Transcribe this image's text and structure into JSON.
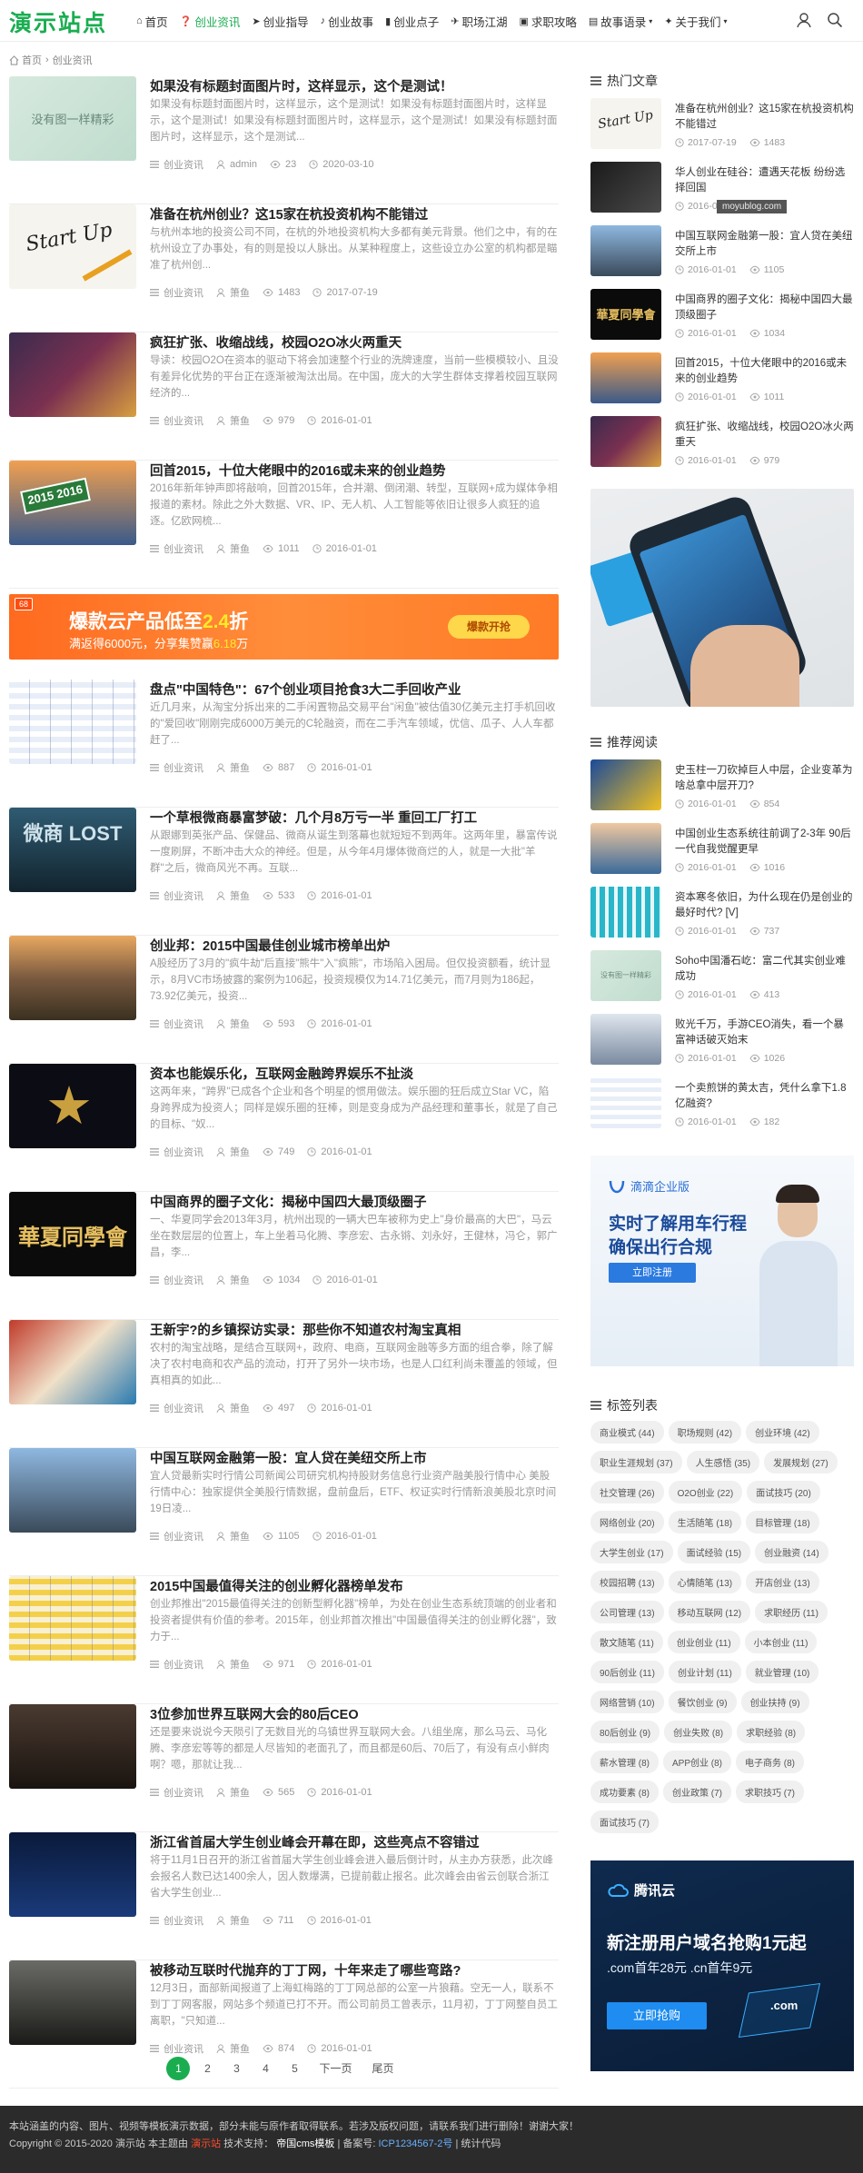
{
  "site": {
    "logo": "演示站点",
    "watermark": "moyublog.com"
  },
  "nav": [
    {
      "label": "首页",
      "icon": "home-icon",
      "glyph": "⌂",
      "active": false
    },
    {
      "label": "创业资讯",
      "icon": "question-icon",
      "glyph": "❓",
      "active": true
    },
    {
      "label": "创业指导",
      "icon": "send-icon",
      "glyph": "➤",
      "active": false
    },
    {
      "label": "创业故事",
      "icon": "bell-icon",
      "glyph": "♪",
      "active": false
    },
    {
      "label": "创业点子",
      "icon": "columns-icon",
      "glyph": "▮",
      "active": false
    },
    {
      "label": "职场江湖",
      "icon": "ticket-icon",
      "glyph": "✈",
      "active": false
    },
    {
      "label": "求职攻略",
      "icon": "print-icon",
      "glyph": "▣",
      "active": false
    },
    {
      "label": "故事语录",
      "icon": "book-icon",
      "glyph": "▤",
      "active": false,
      "dropdown": true
    },
    {
      "label": "关于我们",
      "icon": "user-icon",
      "glyph": "✦",
      "active": false,
      "dropdown": true
    }
  ],
  "breadcrumb": {
    "home": "首页",
    "sep": "›",
    "current": "创业资讯"
  },
  "articles": [
    {
      "title": "如果没有标题封面图片时，这样显示，这个是测试！",
      "summary": "如果没有标题封面图片时，这样显示，这个是测试！如果没有标题封面图片时，这样显示，这个是测试！如果没有标题封面图片时，这样显示，这个是测试！如果没有标题封面图片时，这样显示，这个是测试...",
      "cat": "创业资讯",
      "author": "admin",
      "views": "23",
      "date": "2020-03-10",
      "thumb_text": "没有图一样精彩"
    },
    {
      "title": "准备在杭州创业？这15家在杭投资机构不能错过",
      "summary": "与杭州本地的投资公司不同，在杭的外地投资机构大多都有美元背景。他们之中，有的在杭州设立了办事处，有的则是投以人脉出。从某种程度上，这些设立办公室的机构都是瞄准了杭州创...",
      "cat": "创业资讯",
      "author": "箫鱼",
      "views": "1483",
      "date": "2017-07-19",
      "thumb_text": "Start Up"
    },
    {
      "title": "疯狂扩张、收缩战线，校园O2O冰火两重天",
      "summary": "导读：校园O2O在资本的驱动下将会加速整个行业的洗牌速度，当前一些模模较小、且没有差异化优势的平台正在逐渐被淘汰出局。在中国，庞大的大学生群体支撑着校园互联网经济的...",
      "cat": "创业资讯",
      "author": "箫鱼",
      "views": "979",
      "date": "2016-01-01",
      "thumb_text": ""
    },
    {
      "title": "回首2015，十位大佬眼中的2016或未来的创业趋势",
      "summary": "2016年新年钟声即将敲响，回首2015年，合并潮、倒闭潮、转型，互联网+成为媒体争相报道的素材。除此之外大数据、VR、IP、无人机、人工智能等依旧让很多人疯狂的追逐。亿欧网梳...",
      "cat": "创业资讯",
      "author": "箫鱼",
      "views": "1011",
      "date": "2016-01-01",
      "thumb_text": "2015 2016"
    },
    {
      "title": "盘点\"中国特色\"：67个创业项目抢食3大二手回收产业",
      "summary": "近几月来，从淘宝分拆出来的二手闲置物品交易平台\"闲鱼\"被估值30亿美元主打手机回收的\"爱回收\"刚刚完成6000万美元的C轮融资，而在二手汽车领域，优信、瓜子、人人车都赶了...",
      "cat": "创业资讯",
      "author": "箫鱼",
      "views": "887",
      "date": "2016-01-01",
      "thumb_text": ""
    },
    {
      "title": "一个草根微商暴富梦破：几个月8万亏一半 重回工厂打工",
      "summary": "从跟娜到英张产品、保健品、微商从诞生到落幕也就短短不到两年。这两年里，暴富传说一度刷屏，不断冲击大众的神经。但是，从今年4月爆体微商烂的人，就是一大批\"羊群\"之后，微商风光不再。互联...",
      "cat": "创业资讯",
      "author": "箫鱼",
      "views": "533",
      "date": "2016-01-01",
      "thumb_text": "微商 LOST"
    },
    {
      "title": "创业邦：2015中国最佳创业城市榜单出炉",
      "summary": "A股经历了3月的\"疯牛劫\"后直接\"熊牛\"入\"疯熊\"，市场陷入困局。但仅投资额看，统计显示，8月VC市场披露的案例为106起，投资规模仅为14.71亿美元，而7月则为186起，73.92亿美元，投资...",
      "cat": "创业资讯",
      "author": "箫鱼",
      "views": "593",
      "date": "2016-01-01",
      "thumb_text": ""
    },
    {
      "title": "资本也能娱乐化，互联网金融跨界娱乐不扯淡",
      "summary": "这两年来，\"跨界\"已成各个企业和各个明星的惯用做法。娱乐圈的狂后成立Star VC，陷身跨界成为投资人；同样是娱乐圈的狂棒，则是变身成为产品经理和董事长，就是了自己的目标、\"奴...",
      "cat": "创业资讯",
      "author": "箫鱼",
      "views": "749",
      "date": "2016-01-01",
      "thumb_text": ""
    },
    {
      "title": "中国商界的圈子文化：揭秘中国四大最顶级圈子",
      "summary": "一、华夏同学会2013年3月，杭州出现的一辆大巴车被称为史上\"身价最高的大巴\"，马云坐在数层层的位置上，车上坐着马化腾、李彦宏、古永锵、刘永好，王健林，冯仑，郭广昌，李...",
      "cat": "创业资讯",
      "author": "箫鱼",
      "views": "1034",
      "date": "2016-01-01",
      "thumb_text": "華夏同學會"
    },
    {
      "title": "王新宇?的乡镇探访实录：那些你不知道农村淘宝真相",
      "summary": "农村的淘宝战略，是结合互联网+，政府、电商，互联网金融等多方面的组合拳，除了解决了农村电商和农产品的流动，打开了另外一块市场，也是人口红利尚未覆盖的领域，但真相真的如此...",
      "cat": "创业资讯",
      "author": "箫鱼",
      "views": "497",
      "date": "2016-01-01",
      "thumb_text": ""
    },
    {
      "title": "中国互联网金融第一股：宜人贷在美纽交所上市",
      "summary": "宜人贷最新实时行情公司新闻公司研究机构持股财务信息行业资产融美股行情中心 美股行情中心：独家提供全美股行情数据，盘前盘后，ETF、权证实时行情新浪美股北京时间19日凌...",
      "cat": "创业资讯",
      "author": "箫鱼",
      "views": "1105",
      "date": "2016-01-01",
      "thumb_text": ""
    },
    {
      "title": "2015中国最值得关注的创业孵化器榜单发布",
      "summary": "创业邦推出\"2015最值得关注的创新型孵化器\"榜单，为处在创业生态系统顶端的创业者和投资者提供有价值的参考。2015年，创业邦首次推出\"中国最值得关注的创业孵化器\"，致力于...",
      "cat": "创业资讯",
      "author": "箫鱼",
      "views": "971",
      "date": "2016-01-01",
      "thumb_text": ""
    },
    {
      "title": "3位参加世界互联网大会的80后CEO",
      "summary": "还是要来说说今天陨引了无数目光的乌镇世界互联网大会。八组坐席，那么马云、马化腾、李彦宏等等的都是人尽皆知的老面孔了，而且都是60后、70后了，有没有点小鲜肉啊？嗯，那就让我...",
      "cat": "创业资讯",
      "author": "箫鱼",
      "views": "565",
      "date": "2016-01-01",
      "thumb_text": ""
    },
    {
      "title": "浙江省首届大学生创业峰会开幕在即，这些亮点不容错过",
      "summary": "将于11月1日召开的浙江省首届大学生创业峰会进入最后倒计时，从主办方获悉，此次峰会报名人数已达1400余人，因人数爆满，已提前截止报名。此次峰会由省云创联合浙江省大学生创业...",
      "cat": "创业资讯",
      "author": "箫鱼",
      "views": "711",
      "date": "2016-01-01",
      "thumb_text": ""
    },
    {
      "title": "被移动互联时代抛弃的丁丁网，十年来走了哪些弯路?",
      "summary": "12月3日，面部新闻报道了上海虹梅路的丁丁网总部的公室一片狼藉。空无一人，联系不到丁丁网客服，网站多个频道已打不开。而公司前员工曾表示，11月初，丁丁网整自员工离职，\"只知道...",
      "cat": "创业资讯",
      "author": "箫鱼",
      "views": "874",
      "date": "2016-01-01",
      "thumb_text": ""
    }
  ],
  "ad_banner": {
    "tag": "68",
    "line1_pre": "爆款云产品低至",
    "line1_hl": "2.4",
    "line1_post": "折",
    "line2_pre": "满返得6000元，分享集赞赢",
    "line2_hl": "6.18",
    "line2_post": "万",
    "button": "爆款开抢"
  },
  "pagination": {
    "pages": [
      "1",
      "2",
      "3",
      "4",
      "5"
    ],
    "current": "1",
    "next": "下一页",
    "last": "尾页"
  },
  "sidebar": {
    "hot_title": "热门文章",
    "hot": [
      {
        "title": "准备在杭州创业？这15家在杭投资机构不能错过",
        "date": "2017-07-19",
        "views": "1483"
      },
      {
        "title": "华人创业在硅谷：遭遇天花板 纷纷选择回国",
        "date": "2016-01-01",
        "views": "1105"
      },
      {
        "title": "中国互联网金融第一股：宜人贷在美纽交所上市",
        "date": "2016-01-01",
        "views": "1105"
      },
      {
        "title": "中国商界的圈子文化：揭秘中国四大最顶级圈子",
        "date": "2016-01-01",
        "views": "1034"
      },
      {
        "title": "回首2015，十位大佬眼中的2016或未来的创业趋势",
        "date": "2016-01-01",
        "views": "1011"
      },
      {
        "title": "疯狂扩张、收缩战线，校园O2O冰火两重天",
        "date": "2016-01-01",
        "views": "979"
      }
    ],
    "rec_title": "推荐阅读",
    "rec": [
      {
        "title": "史玉柱一刀砍掉巨人中层，企业变革为啥总拿中层开刀?",
        "date": "2016-01-01",
        "views": "854"
      },
      {
        "title": "中国创业生态系统往前调了2-3年 90后一代自我觉醒更早",
        "date": "2016-01-01",
        "views": "1016"
      },
      {
        "title": "资本寒冬依旧，为什么现在仍是创业的最好时代? [V]",
        "date": "2016-01-01",
        "views": "737"
      },
      {
        "title": "Soho中国潘石屹：富二代其实创业难成功",
        "date": "2016-01-01",
        "views": "413"
      },
      {
        "title": "败光千万，手游CEO消失，看一个暴富神话破灭始末",
        "date": "2016-01-01",
        "views": "1026"
      },
      {
        "title": "一个卖煎饼的黄太吉，凭什么拿下1.8亿融资?",
        "date": "2016-01-01",
        "views": "182"
      }
    ],
    "rec_thumb_text": "没有图一样精彩",
    "didi_ad": {
      "brand": "滴滴企业版",
      "line1": "实时了解用车行程",
      "line2": "确保出行合规",
      "button": "立即注册"
    },
    "tags_title": "标签列表",
    "tags": [
      "商业模式 (44)",
      "职场规则 (42)",
      "创业环境 (42)",
      "职业生涯规划 (37)",
      "人生感悟 (35)",
      "发展规划 (27)",
      "社交管理 (26)",
      "O2O创业 (22)",
      "面试技巧 (20)",
      "网络创业 (20)",
      "生活随笔 (18)",
      "目标管理 (18)",
      "大学生创业 (17)",
      "面试经验 (15)",
      "创业融资 (14)",
      "校园招聘 (13)",
      "心情随笔 (13)",
      "开店创业 (13)",
      "公司管理 (13)",
      "移动互联网 (12)",
      "求职经历 (11)",
      "散文随笔 (11)",
      "创业创业 (11)",
      "小本创业 (11)",
      "90后创业 (11)",
      "创业计划 (11)",
      "就业管理 (10)",
      "网络营销 (10)",
      "餐饮创业 (9)",
      "创业扶持 (9)",
      "80后创业 (9)",
      "创业失败 (8)",
      "求职经验 (8)",
      "薪水管理 (8)",
      "APP创业 (8)",
      "电子商务 (8)",
      "成功要素 (8)",
      "创业政策 (7)",
      "求职技巧 (7)",
      "面试技巧 (7)"
    ],
    "tencent_ad": {
      "brand": "腾讯云",
      "line1": "新注册用户域名抢购1元起",
      "line2": ".com首年28元 .cn首年9元",
      "button": "立即抢购",
      "badge": ".com"
    }
  },
  "footer": {
    "line1": "本站涵盖的内容、图片、视频等模板演示数据，部分未能与原作者取得联系。若涉及版权问题，请联系我们进行删除！谢谢大家！",
    "line2_pre": "Copyright © 2015-2020 演示站 本主题由",
    "line2_red": "演示站",
    "line2_mid": "技术支持：",
    "line2_cms": "帝国cms模板",
    "line2_beian_label": "| 备案号:",
    "line2_beian": "ICP1234567-2号",
    "line2_stat": "| 统计代码"
  }
}
